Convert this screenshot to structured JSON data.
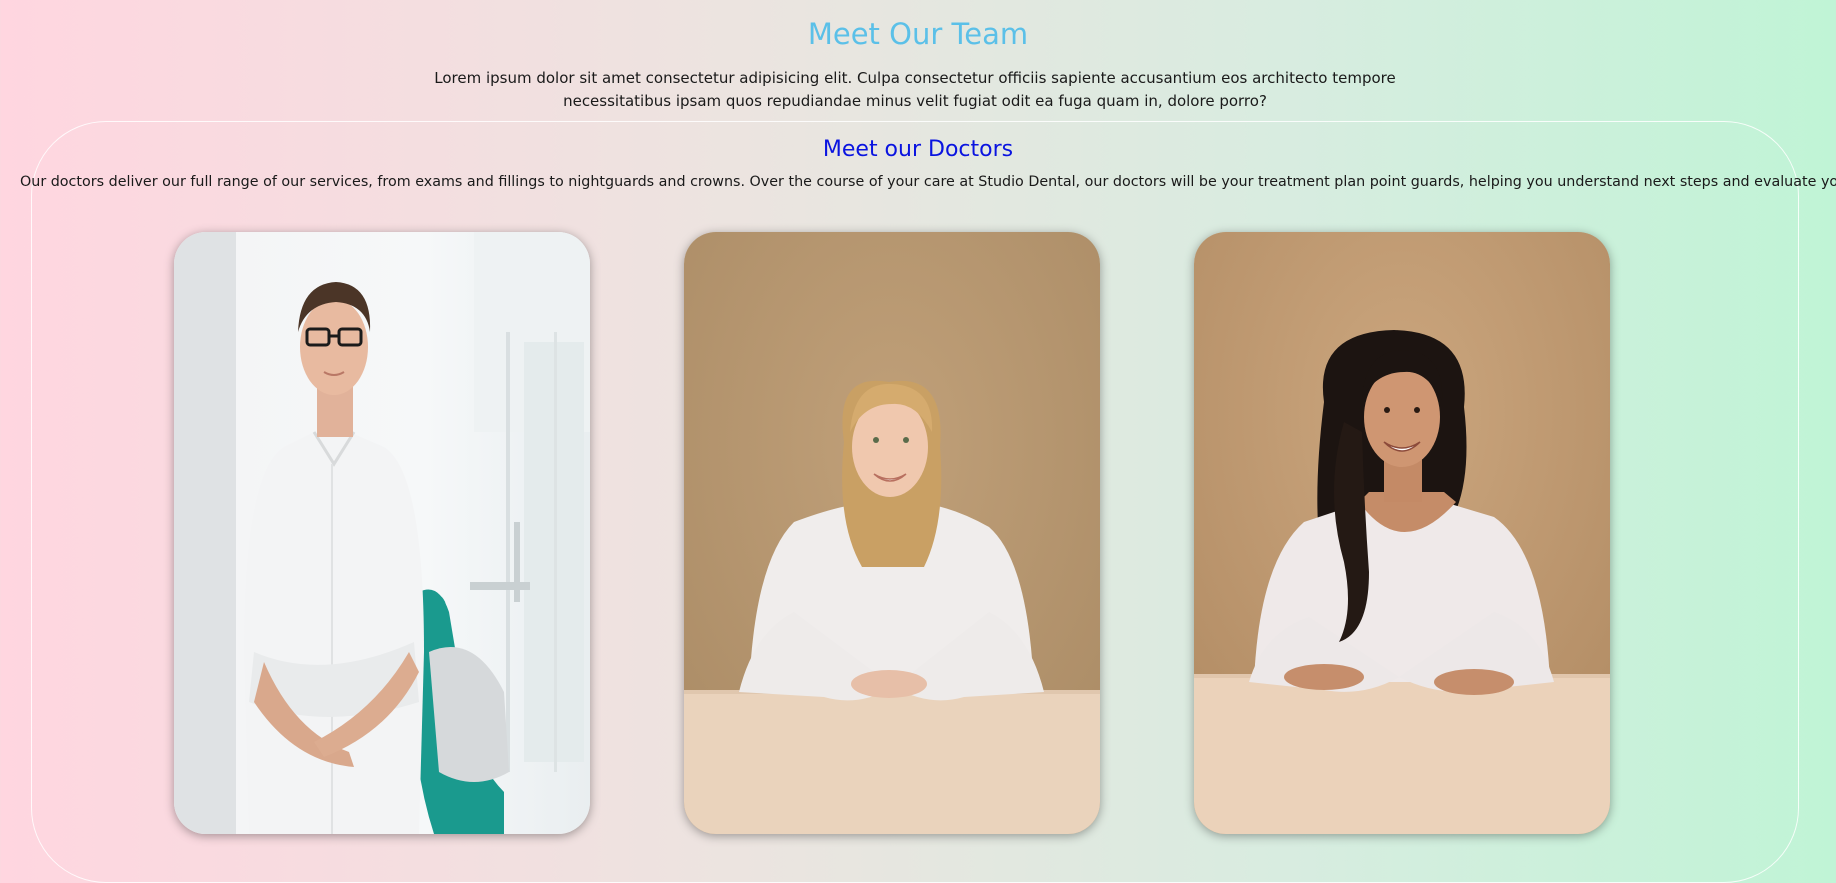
{
  "header": {
    "title": "Meet Our Team",
    "intro": "Lorem ipsum dolor sit amet consectetur adipisicing elit. Culpa consectetur officiis sapiente accusantium eos architecto tempore necessitatibus ipsam quos repudiandae minus velit fugiat odit ea fuga quam in, dolore porro?"
  },
  "doctors_section": {
    "title": "Meet our Doctors",
    "description": "Our doctors deliver our full range of our services, from exams and fillings to nightguards and crowns. Over the course of your care at Studio Dental, our doctors will be your treatment plan point guards, helping you understand next steps and evaluate your options.",
    "cards": [
      {
        "photo": "male-dentist-in-clinic"
      },
      {
        "photo": "blonde-woman-portrait"
      },
      {
        "photo": "dark-haired-woman-portrait"
      }
    ]
  },
  "colors": {
    "title": "#5bc0e8",
    "section_title": "#0a14e0",
    "background_left": "#ffd6e0",
    "background_right": "#c0f4d6"
  }
}
